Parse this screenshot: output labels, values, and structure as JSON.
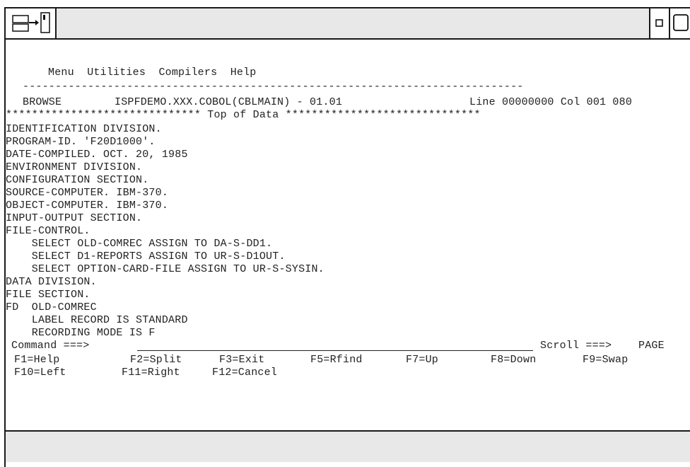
{
  "window": {
    "system_menu_icon": "window-menu-icon",
    "minimize_icon": "minimize-icon",
    "maximize_icon": "maximize-icon"
  },
  "menu": {
    "items": [
      "Menu",
      "Utilities",
      "Compilers",
      "Help"
    ]
  },
  "separator": "-----------------------------------------------------------------------------",
  "header": {
    "mode": "BROWSE",
    "dataset": "ISPFDEMO.XXX.COBOL(CBLMAIN) - 01.01",
    "position": "Line 00000000 Col 001 080"
  },
  "top_of_data": "****************************** Top of Data ******************************",
  "source_lines": [
    "IDENTIFICATION DIVISION.",
    "PROGRAM-ID. 'F20D1000'.",
    "DATE-COMPILED. OCT. 20, 1985",
    "ENVIRONMENT DIVISION.",
    "CONFIGURATION SECTION.",
    "SOURCE-COMPUTER. IBM-370.",
    "OBJECT-COMPUTER. IBM-370.",
    "INPUT-OUTPUT SECTION.",
    "FILE-CONTROL.",
    "    SELECT OLD-COMREC ASSIGN TO DA-S-DD1.",
    "    SELECT D1-REPORTS ASSIGN TO UR-S-D1OUT.",
    "    SELECT OPTION-CARD-FILE ASSIGN TO UR-S-SYSIN.",
    "DATA DIVISION.",
    "FILE SECTION.",
    "FD  OLD-COMREC",
    "    LABEL RECORD IS STANDARD",
    "    RECORDING MODE IS F"
  ],
  "command": {
    "label": "Command ===>",
    "value": "",
    "scroll_label": "Scroll ===>",
    "scroll_value": "PAGE"
  },
  "fkeys_row1": [
    "F1=Help",
    "F2=Split",
    "F3=Exit",
    "F5=Rfind",
    "F7=Up",
    "F8=Down",
    "F9=Swap"
  ],
  "fkeys_row2": [
    "F10=Left",
    "F11=Right",
    "F12=Cancel"
  ]
}
